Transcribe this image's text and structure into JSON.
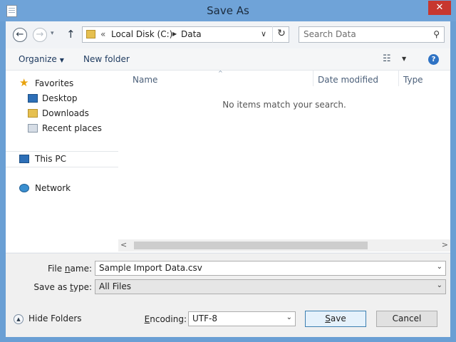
{
  "window": {
    "title": "Save As",
    "close_glyph": "✕"
  },
  "nav": {
    "back_glyph": "←",
    "forward_glyph": "→",
    "recent_glyph": "▾",
    "up_glyph": "↑"
  },
  "address": {
    "overflow_glyph": "«",
    "segments": [
      "Local Disk (C:)",
      "Data"
    ],
    "separator_glyph": "▶",
    "dropdown_glyph": "∨",
    "refresh_glyph": "↻"
  },
  "search": {
    "placeholder": "Search Data",
    "icon_glyph": "⚲"
  },
  "toolbar": {
    "organize_label": "Organize",
    "caret_glyph": "▼",
    "new_folder_label": "New folder",
    "view_glyph": "☷",
    "view_dropdown_glyph": "▼",
    "help_glyph": "?"
  },
  "sidebar": {
    "items": [
      {
        "label": "Favorites",
        "icon": "star-icon"
      },
      {
        "label": "Desktop",
        "icon": "desktop-icon"
      },
      {
        "label": "Downloads",
        "icon": "downloads-folder-icon"
      },
      {
        "label": "Recent places",
        "icon": "recent-places-icon"
      },
      {
        "label": "This PC",
        "icon": "computer-icon"
      },
      {
        "label": "Network",
        "icon": "network-icon"
      }
    ],
    "star_glyph": "★"
  },
  "content": {
    "columns": [
      "Name",
      "Date modified",
      "Type"
    ],
    "sort_glyph": "^",
    "empty_message": "No items match your search.",
    "scroll_left_glyph": "<",
    "scroll_right_glyph": ">"
  },
  "form": {
    "file_name_label_pre": "File ",
    "file_name_label_u": "n",
    "file_name_label_post": "ame:",
    "file_name_value": "Sample Import Data.csv",
    "save_type_label_pre": "Save as ",
    "save_type_label_u": "t",
    "save_type_label_post": "ype:",
    "save_type_value": "All Files",
    "encoding_label_u": "E",
    "encoding_label_post": "ncoding:",
    "encoding_value": "UTF-8",
    "dropdown_glyph": "⌄",
    "hide_folders_label": "Hide Folders",
    "hide_folders_glyph": "▲",
    "save_label_u": "S",
    "save_label_post": "ave",
    "cancel_label": "Cancel"
  }
}
